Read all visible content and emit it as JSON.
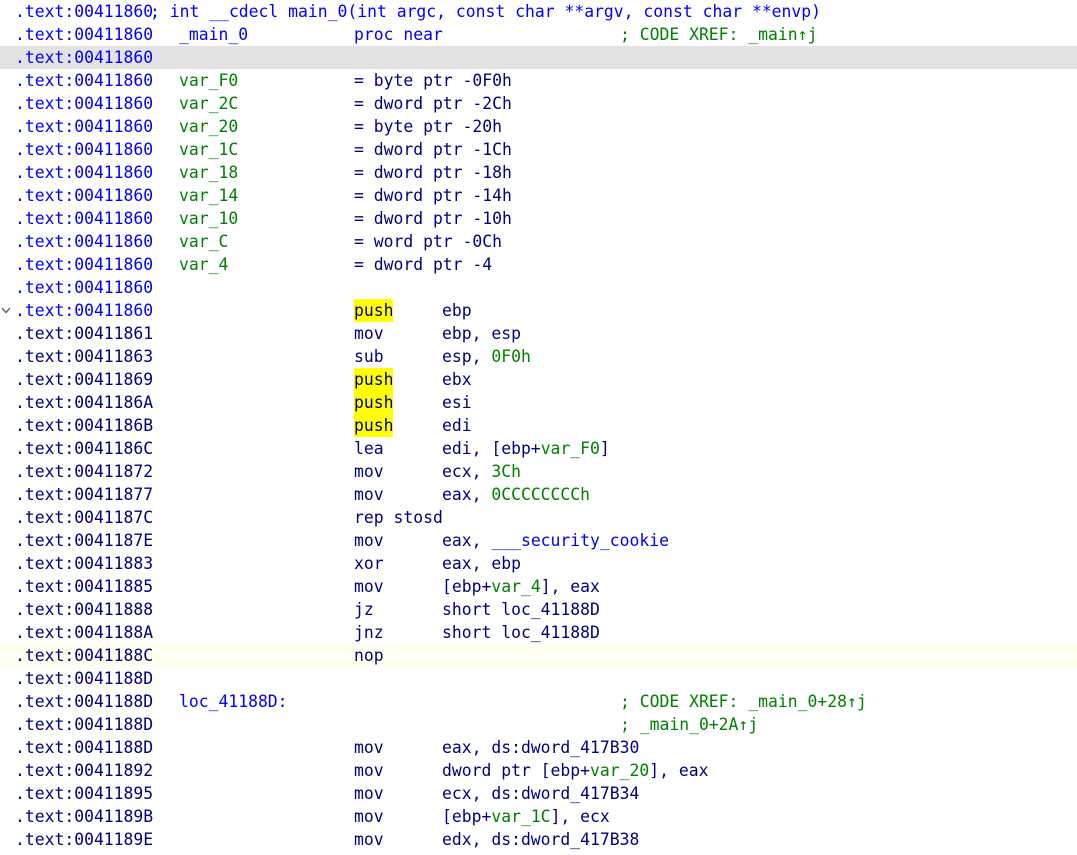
{
  "colors": {
    "code_address": "#0000ff",
    "data_address": "#000080",
    "name": "#008000",
    "highlight": "#ffff00"
  },
  "lines": [
    {
      "addr": ".text:00411860",
      "ac": "blue",
      "parts": [
        {
          "t": " ; int __cdecl main_0(int argc, const char **argv, const char **envp)",
          "c": "blue"
        }
      ]
    },
    {
      "addr": ".text:00411860",
      "ac": "blue",
      "parts": [
        {
          "t": " _main_0         proc near               ; CODE XREF: _main↑j",
          "c": "blue"
        }
      ]
    },
    {
      "addr": ".text:00411860",
      "ac": "blue",
      "sel": true,
      "parts": []
    },
    {
      "addr": ".text:00411860",
      "ac": "blue",
      "label": "var_F0",
      "mnem": "= byte ptr -0F0h"
    },
    {
      "addr": ".text:00411860",
      "ac": "blue",
      "label": "var_2C",
      "mnem": "= dword ptr -2Ch"
    },
    {
      "addr": ".text:00411860",
      "ac": "blue",
      "label": "var_20",
      "mnem": "= byte ptr -20h"
    },
    {
      "addr": ".text:00411860",
      "ac": "blue",
      "label": "var_1C",
      "mnem": "= dword ptr -1Ch"
    },
    {
      "addr": ".text:00411860",
      "ac": "blue",
      "label": "var_18",
      "mnem": "= dword ptr -18h"
    },
    {
      "addr": ".text:00411860",
      "ac": "blue",
      "label": "var_14",
      "mnem": "= dword ptr -14h"
    },
    {
      "addr": ".text:00411860",
      "ac": "blue",
      "label": "var_10",
      "mnem": "= dword ptr -10h"
    },
    {
      "addr": ".text:00411860",
      "ac": "blue",
      "label": "var_C",
      "mnem": "= word ptr -0Ch"
    },
    {
      "addr": ".text:00411860",
      "ac": "blue",
      "label": "var_4",
      "mnem": "= dword ptr -4"
    },
    {
      "addr": ".text:00411860",
      "ac": "blue"
    },
    {
      "addr": ".text:00411860",
      "ac": "blue",
      "fold": true,
      "mnem": "push",
      "hl": true,
      "ops": "ebp"
    },
    {
      "addr": ".text:00411861",
      "ac": "black",
      "mnem": "mov",
      "ops": "ebp, esp"
    },
    {
      "addr": ".text:00411863",
      "ac": "black",
      "mnem": "sub",
      "ops": "esp, 0F0h"
    },
    {
      "addr": ".text:00411869",
      "ac": "black",
      "mnem": "push",
      "hl": true,
      "ops": "ebx"
    },
    {
      "addr": ".text:0041186A",
      "ac": "black",
      "mnem": "push",
      "hl": true,
      "ops": "esi"
    },
    {
      "addr": ".text:0041186B",
      "ac": "black",
      "mnem": "push",
      "hl": true,
      "ops": "edi"
    },
    {
      "addr": ".text:0041186C",
      "ac": "black",
      "mnem": "lea",
      "ops": "edi, [ebp+var_F0]"
    },
    {
      "addr": ".text:00411872",
      "ac": "black",
      "mnem": "mov",
      "ops": "ecx, 3Ch"
    },
    {
      "addr": ".text:00411877",
      "ac": "black",
      "mnem": "mov",
      "ops": "eax, 0CCCCCCCCh"
    },
    {
      "addr": ".text:0041187C",
      "ac": "black",
      "mnem": "rep stosd"
    },
    {
      "addr": ".text:0041187E",
      "ac": "black",
      "mnem": "mov",
      "ops": "eax, ___security_cookie"
    },
    {
      "addr": ".text:00411883",
      "ac": "black",
      "mnem": "xor",
      "ops": "eax, ebp"
    },
    {
      "addr": ".text:00411885",
      "ac": "black",
      "mnem": "mov",
      "ops": "[ebp+var_4], eax"
    },
    {
      "addr": ".text:00411888",
      "ac": "black",
      "mnem": "jz",
      "ops": "short loc_41188D"
    },
    {
      "addr": ".text:0041188A",
      "ac": "black",
      "mnem": "jnz",
      "ops": "short loc_41188D"
    },
    {
      "addr": ".text:0041188C",
      "ac": "black",
      "cur": true,
      "mnem": "nop"
    },
    {
      "addr": ".text:0041188D",
      "ac": "black"
    },
    {
      "addr": ".text:0041188D",
      "ac": "black",
      "label": "loc_41188D:",
      "lc": "blue",
      "comment": "; CODE XREF: _main_0+28↑j"
    },
    {
      "addr": ".text:0041188D",
      "ac": "black",
      "comment": "; _main_0+2A↑j"
    },
    {
      "addr": ".text:0041188D",
      "ac": "black",
      "mnem": "mov",
      "ops": "eax, ds:dword_417B30"
    },
    {
      "addr": ".text:00411892",
      "ac": "black",
      "mnem": "mov",
      "ops": "dword ptr [ebp+var_20], eax"
    },
    {
      "addr": ".text:00411895",
      "ac": "black",
      "mnem": "mov",
      "ops": "ecx, ds:dword_417B34"
    },
    {
      "addr": ".text:0041189B",
      "ac": "black",
      "mnem": "mov",
      "ops": "[ebp+var_1C], ecx"
    },
    {
      "addr": ".text:0041189E",
      "ac": "black",
      "mnem": "mov",
      "ops": "edx, ds:dword_417B38"
    }
  ]
}
